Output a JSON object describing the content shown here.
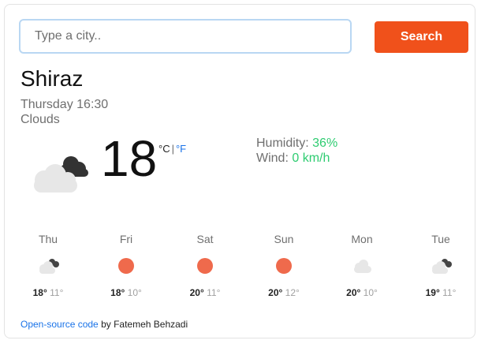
{
  "search": {
    "placeholder": "Type a city..",
    "button_label": "Search"
  },
  "current": {
    "city": "Shiraz",
    "day_time": "Thursday 16:30",
    "description": "Clouds",
    "icon": "broken-clouds-icon",
    "temperature": "18",
    "unit_celsius": "°C",
    "unit_separator": "|",
    "unit_fahrenheit": "°F",
    "humidity_label": "Humidity:",
    "humidity_value": "36%",
    "wind_label": "Wind:",
    "wind_value": "0 km/h"
  },
  "forecast": [
    {
      "day": "Thu",
      "icon": "cloud",
      "hi": "18°",
      "lo": "11°"
    },
    {
      "day": "Fri",
      "icon": "sun",
      "hi": "18°",
      "lo": "10°"
    },
    {
      "day": "Sat",
      "icon": "sun",
      "hi": "20°",
      "lo": "11°"
    },
    {
      "day": "Sun",
      "icon": "sun",
      "hi": "20°",
      "lo": "12°"
    },
    {
      "day": "Mon",
      "icon": "light-cloud",
      "hi": "20°",
      "lo": "10°"
    },
    {
      "day": "Tue",
      "icon": "cloud",
      "hi": "19°",
      "lo": "11°"
    }
  ],
  "footer": {
    "link_text": "Open-source code",
    "by_text": "by Fatemeh Behzadi"
  },
  "colors": {
    "accent": "#f0511b",
    "link": "#1a73e8",
    "value_green": "#2ecc71",
    "sun": "#ef6a4c"
  }
}
